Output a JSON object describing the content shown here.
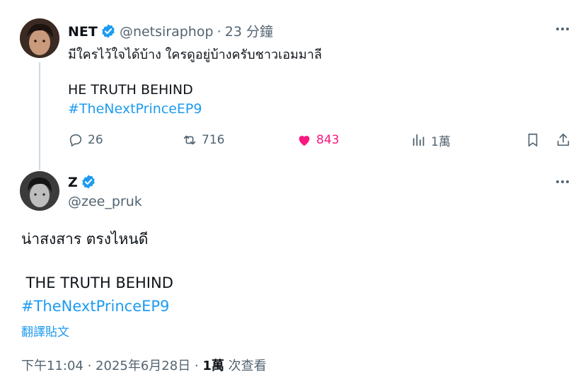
{
  "tweet1": {
    "name": "NET",
    "handle": "@netsiraphop",
    "dot": "·",
    "time": "23 分鐘",
    "line1": "มีใครไว้ใจได้บ้าง  ใครดูอยู่บ้างครับชาวเอมมาลี",
    "line2": "HE TRUTH BEHIND",
    "hashtag": "#TheNextPrinceEP9",
    "replies": "26",
    "retweets": "716",
    "likes": "843",
    "views": "1萬"
  },
  "tweet2": {
    "name": "Z",
    "handle": "@zee_pruk",
    "line1": "น่าสงสาร ตรงไหนดี",
    "line2": " THE TRUTH BEHIND",
    "hashtag": "#TheNextPrinceEP9",
    "translate": "翻譯貼文",
    "time": "下午11:04 · 2025年6月28日 · ",
    "views_count": "1萬",
    "views_label": " 次查看"
  },
  "colors": {
    "accent": "#1d9bf0",
    "like": "#f91880",
    "muted": "#536471",
    "thread": "#cfd9de"
  },
  "icons": [
    "verified-badge-icon",
    "more-icon",
    "reply-icon",
    "retweet-icon",
    "heart-icon",
    "views-icon",
    "bookmark-icon",
    "share-icon"
  ]
}
